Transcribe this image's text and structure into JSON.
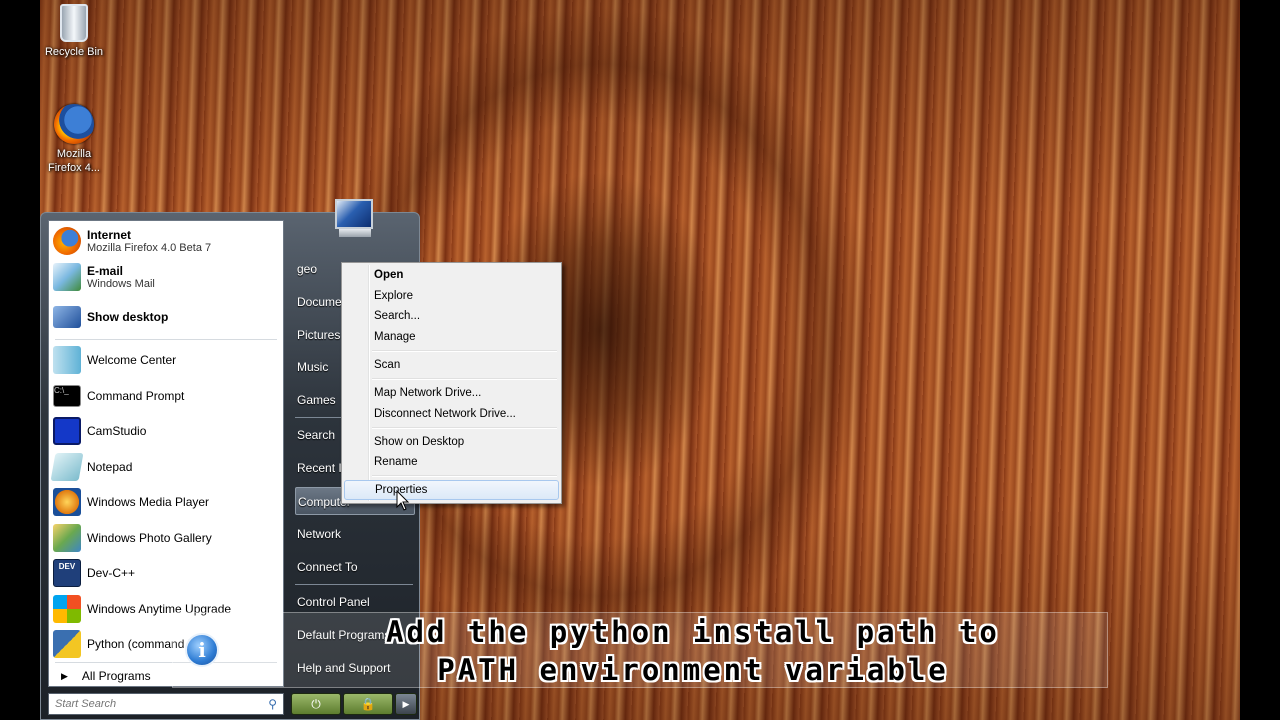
{
  "desktop": {
    "icons": [
      {
        "label": "Recycle Bin",
        "icon": "recycle-bin-icon"
      },
      {
        "label": "Mozilla Firefox 4...",
        "icon": "firefox-icon"
      }
    ]
  },
  "start_menu": {
    "pinned": [
      {
        "title": "Internet",
        "subtitle": "Mozilla Firefox 4.0 Beta 7",
        "icon": "firefox-icon"
      },
      {
        "title": "E-mail",
        "subtitle": "Windows Mail",
        "icon": "mail-icon"
      },
      {
        "title": "Show desktop",
        "subtitle": "",
        "icon": "show-desktop-icon"
      }
    ],
    "recent": [
      {
        "label": "Welcome Center",
        "icon": "welcome-center-icon"
      },
      {
        "label": "Command Prompt",
        "icon": "command-prompt-icon"
      },
      {
        "label": "CamStudio",
        "icon": "camstudio-icon"
      },
      {
        "label": "Notepad",
        "icon": "notepad-icon"
      },
      {
        "label": "Windows Media Player",
        "icon": "media-player-icon"
      },
      {
        "label": "Windows Photo Gallery",
        "icon": "photo-gallery-icon"
      },
      {
        "label": "Dev-C++",
        "icon": "dev-cpp-icon"
      },
      {
        "label": "Windows Anytime Upgrade",
        "icon": "windows-flag-icon"
      },
      {
        "label": "Python (command line)",
        "icon": "python-icon"
      }
    ],
    "all_programs": "All Programs",
    "search_placeholder": "Start Search",
    "right": {
      "user": "geo",
      "documents": "Documents",
      "pictures": "Pictures",
      "music": "Music",
      "games": "Games",
      "search": "Search",
      "recent_items": "Recent Items",
      "computer": "Computer",
      "network": "Network",
      "connect_to": "Connect To",
      "control_panel": "Control Panel",
      "default_programs": "Default Programs",
      "help": "Help and Support"
    },
    "colors": {
      "power_button": "#6f9340"
    }
  },
  "context_menu": {
    "items": [
      {
        "label": "Open",
        "bold": true
      },
      {
        "label": "Explore"
      },
      {
        "label": "Search..."
      },
      {
        "label": "Manage"
      },
      {
        "label": "Scan"
      },
      {
        "label": "Map Network Drive..."
      },
      {
        "label": "Disconnect Network Drive..."
      },
      {
        "label": "Show on Desktop"
      },
      {
        "label": "Rename"
      },
      {
        "label": "Properties",
        "highlighted": true
      }
    ]
  },
  "annotation": {
    "line1": "Add the python install path to",
    "line2": "PATH environment variable",
    "icon": "info-icon"
  }
}
